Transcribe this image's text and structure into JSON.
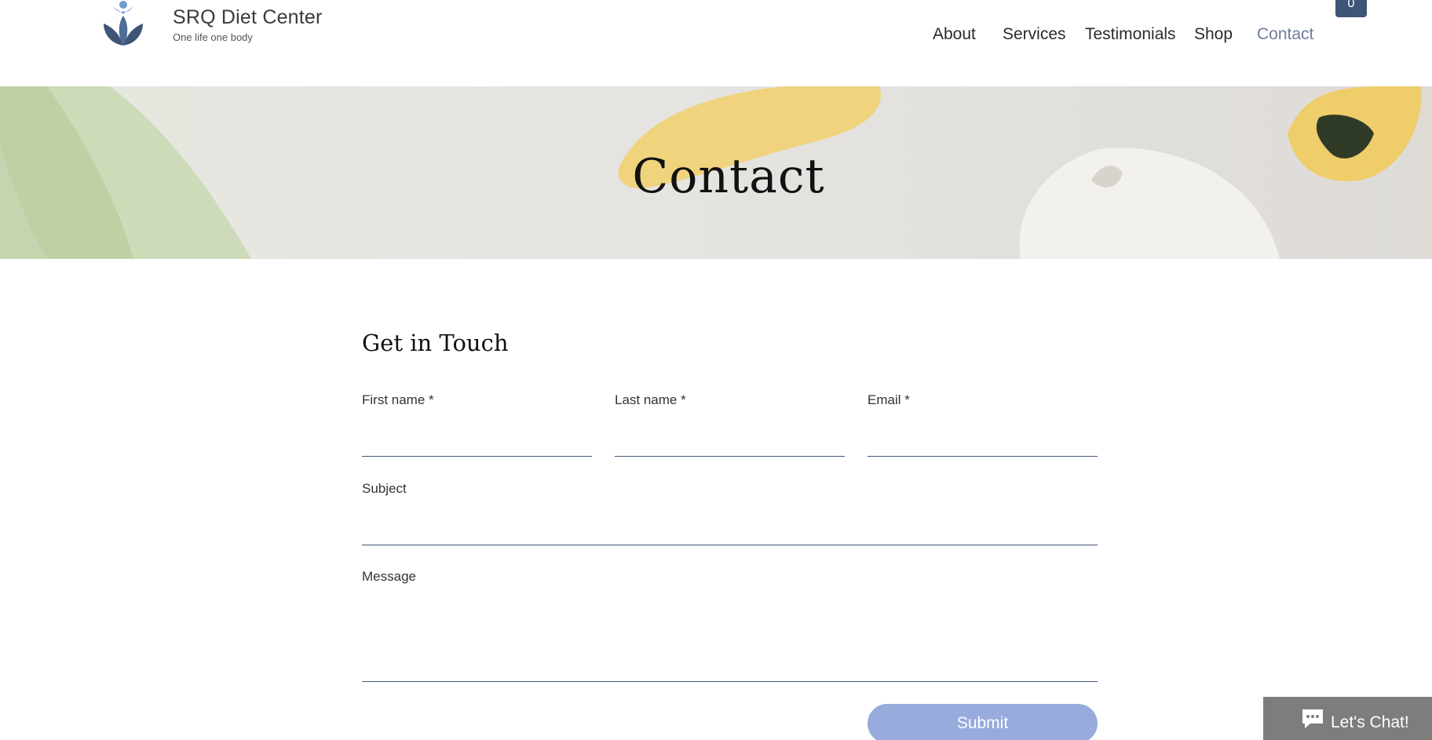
{
  "header": {
    "brand_name": "SRQ Diet Center",
    "tagline": "One life one body",
    "nav": [
      {
        "label": "About"
      },
      {
        "label": "Services"
      },
      {
        "label": "Testimonials"
      },
      {
        "label": "Shop"
      },
      {
        "label": "Contact",
        "active": true
      }
    ],
    "cart_count": "0"
  },
  "hero": {
    "title": "Contact"
  },
  "form": {
    "title": "Get in Touch",
    "first_name_label": "First name *",
    "last_name_label": "Last name *",
    "email_label": "Email *",
    "subject_label": "Subject",
    "message_label": "Message",
    "first_name_value": "",
    "last_name_value": "",
    "email_value": "",
    "subject_value": "",
    "message_value": "",
    "submit_label": "Submit"
  },
  "chat": {
    "label": "Let's Chat!"
  },
  "colors": {
    "accent": "#3f5577",
    "active_nav": "#6f7d9c",
    "submit": "#97acdc",
    "chat_bg": "#7d7d7d"
  }
}
